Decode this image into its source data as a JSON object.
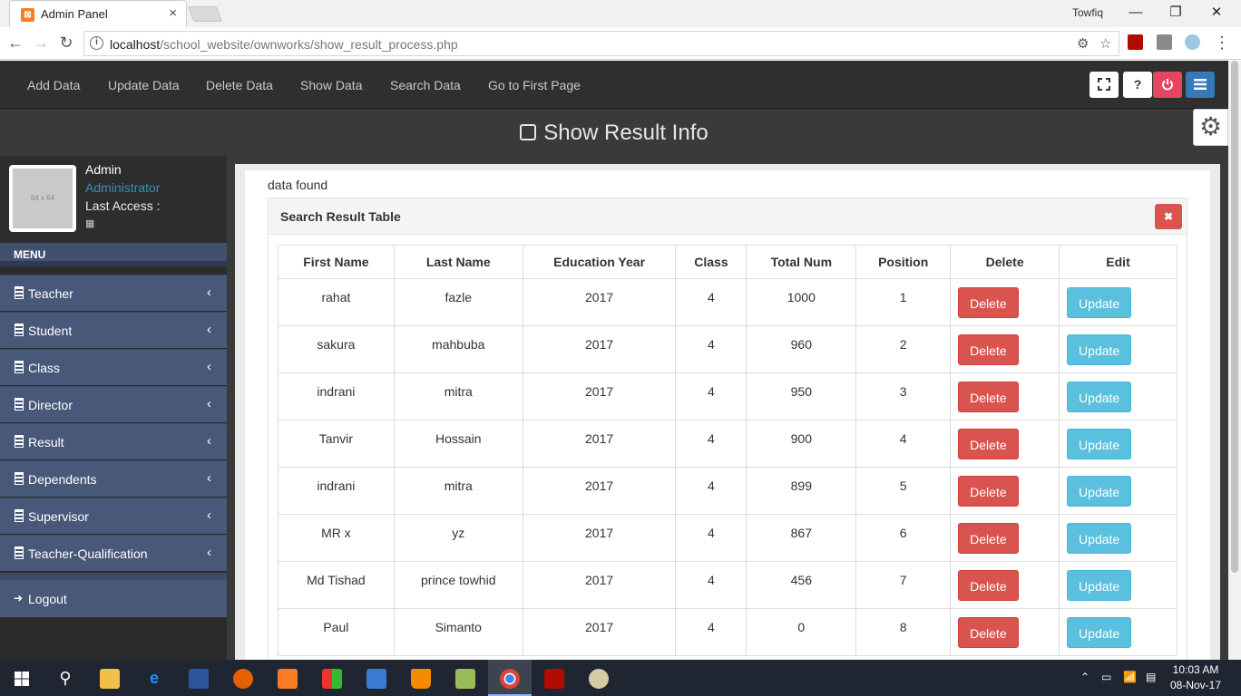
{
  "browser": {
    "tab_title": "Admin Panel",
    "tab_close": "×",
    "profile_name": "Towfiq",
    "url_host": "localhost",
    "url_path": "/school_website/ownworks/show_result_process.php"
  },
  "topnav": {
    "links": [
      "Add Data",
      "Update Data",
      "Delete Data",
      "Show Data",
      "Search Data",
      "Go to First Page"
    ],
    "help_label": "?"
  },
  "page_title": "Show Result Info",
  "sidebar": {
    "avatar_placeholder": "64 x 64",
    "user_name": "Admin",
    "user_role": "Administrator",
    "last_access_label": "Last Access :",
    "menu_header": "MENU",
    "items": [
      {
        "label": "Teacher"
      },
      {
        "label": "Student"
      },
      {
        "label": "Class"
      },
      {
        "label": "Director"
      },
      {
        "label": "Result"
      },
      {
        "label": "Dependents"
      },
      {
        "label": "Supervisor"
      },
      {
        "label": "Teacher-Qualification"
      }
    ],
    "logout_label": "Logout"
  },
  "content": {
    "status_text": "data found",
    "box_title": "Search Result Table",
    "close_label": "✖",
    "columns": [
      "First Name",
      "Last Name",
      "Education Year",
      "Class",
      "Total Num",
      "Position",
      "Delete",
      "Edit"
    ],
    "delete_label": "Delete",
    "update_label": "Update",
    "rows": [
      [
        "rahat",
        "fazle",
        "2017",
        "4",
        "1000",
        "1"
      ],
      [
        "sakura",
        "mahbuba",
        "2017",
        "4",
        "960",
        "2"
      ],
      [
        "indrani",
        "mitra",
        "2017",
        "4",
        "950",
        "3"
      ],
      [
        "Tanvir",
        "Hossain",
        "2017",
        "4",
        "900",
        "4"
      ],
      [
        "indrani",
        "mitra",
        "2017",
        "4",
        "899",
        "5"
      ],
      [
        "MR x",
        "yz",
        "2017",
        "4",
        "867",
        "6"
      ],
      [
        "Md Tishad",
        "prince towhid",
        "2017",
        "4",
        "456",
        "7"
      ],
      [
        "Paul",
        "Simanto",
        "2017",
        "4",
        "0",
        "8"
      ]
    ]
  },
  "taskbar": {
    "time": "10:03 AM",
    "date": "08-Nov-17"
  },
  "colors": {
    "danger": "#d9534f",
    "info": "#5bc0de",
    "sidebar_menu": "#485878",
    "power": "#e94560",
    "menu_btn": "#337ab7"
  }
}
